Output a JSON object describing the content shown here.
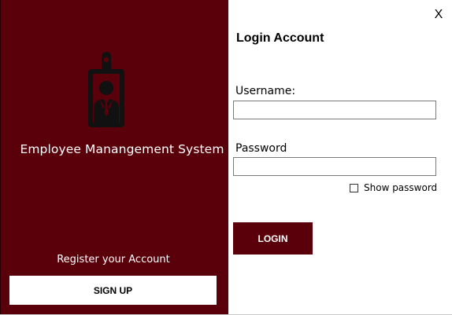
{
  "window": {
    "close_label": "X"
  },
  "left_panel": {
    "icon": "employee-id-badge-icon",
    "app_title": "Employee Manangement System",
    "register_text": "Register your Account",
    "signup_label": "SIGN UP",
    "background_color": "#5a000a"
  },
  "login_form": {
    "title": "Login Account",
    "username_label": "Username:",
    "username_value": "",
    "password_label": "Password",
    "password_value": "",
    "show_password_label": "Show password",
    "show_password_checked": false,
    "login_label": "LOGIN",
    "accent_color": "#5a000a"
  }
}
